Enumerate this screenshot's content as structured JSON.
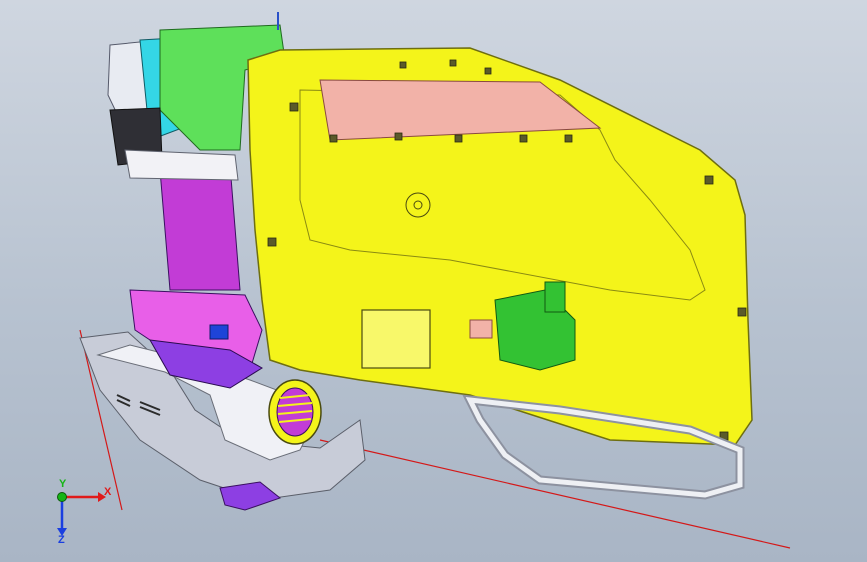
{
  "viewport": {
    "background_top": "#cfd6e0",
    "background_bottom": "#a9b5c5"
  },
  "colors": {
    "door_panel": "#f4f41a",
    "panel_edge": "#6e6e10",
    "green_part": "#5ee05a",
    "green_bracket": "#33c233",
    "magenta_part": "#c23cd6",
    "violet_part": "#8d3fe3",
    "cyan_part": "#34d6e6",
    "pink_panel": "#f2b2a8",
    "white_housing": "#eef0f4",
    "grey_shell": "#bfc4d2",
    "blue_block": "#1e44d8",
    "section_line": "#d41818"
  },
  "triad": {
    "x_label": "X",
    "y_label": "Y",
    "z_label": "Z",
    "x_color": "#e01a1a",
    "y_color": "#16b516",
    "z_color": "#1a3fe0"
  }
}
